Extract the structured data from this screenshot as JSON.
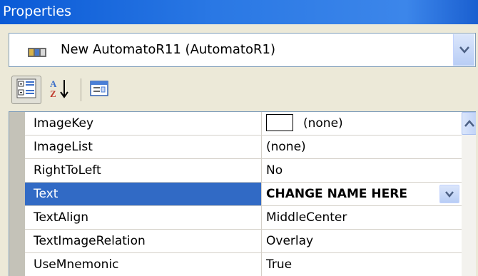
{
  "window": {
    "title": "Properties"
  },
  "object_selector": {
    "value": "New AutomatoR11 (AutomatoR1)",
    "icon": "component-icon"
  },
  "toolbar": {
    "buttons": [
      {
        "name": "categorized-icon",
        "pressed": true
      },
      {
        "name": "alphabetical-icon",
        "pressed": false
      },
      {
        "name": "property-pages-icon",
        "pressed": false
      }
    ]
  },
  "properties": [
    {
      "name": "ImageKey",
      "value": "(none)",
      "has_swatch": true
    },
    {
      "name": "ImageList",
      "value": "(none)"
    },
    {
      "name": "RightToLeft",
      "value": "No"
    },
    {
      "name": "Text",
      "value": "CHANGE NAME HERE",
      "selected": true,
      "has_dropdown": true
    },
    {
      "name": "TextAlign",
      "value": "MiddleCenter"
    },
    {
      "name": "TextImageRelation",
      "value": "Overlay"
    },
    {
      "name": "UseMnemonic",
      "value": "True"
    }
  ],
  "colors": {
    "title_bar": "#2a78e4",
    "selection": "#316ac5",
    "chrome": "#ece9d8",
    "gutter": "#c4c2b8"
  }
}
